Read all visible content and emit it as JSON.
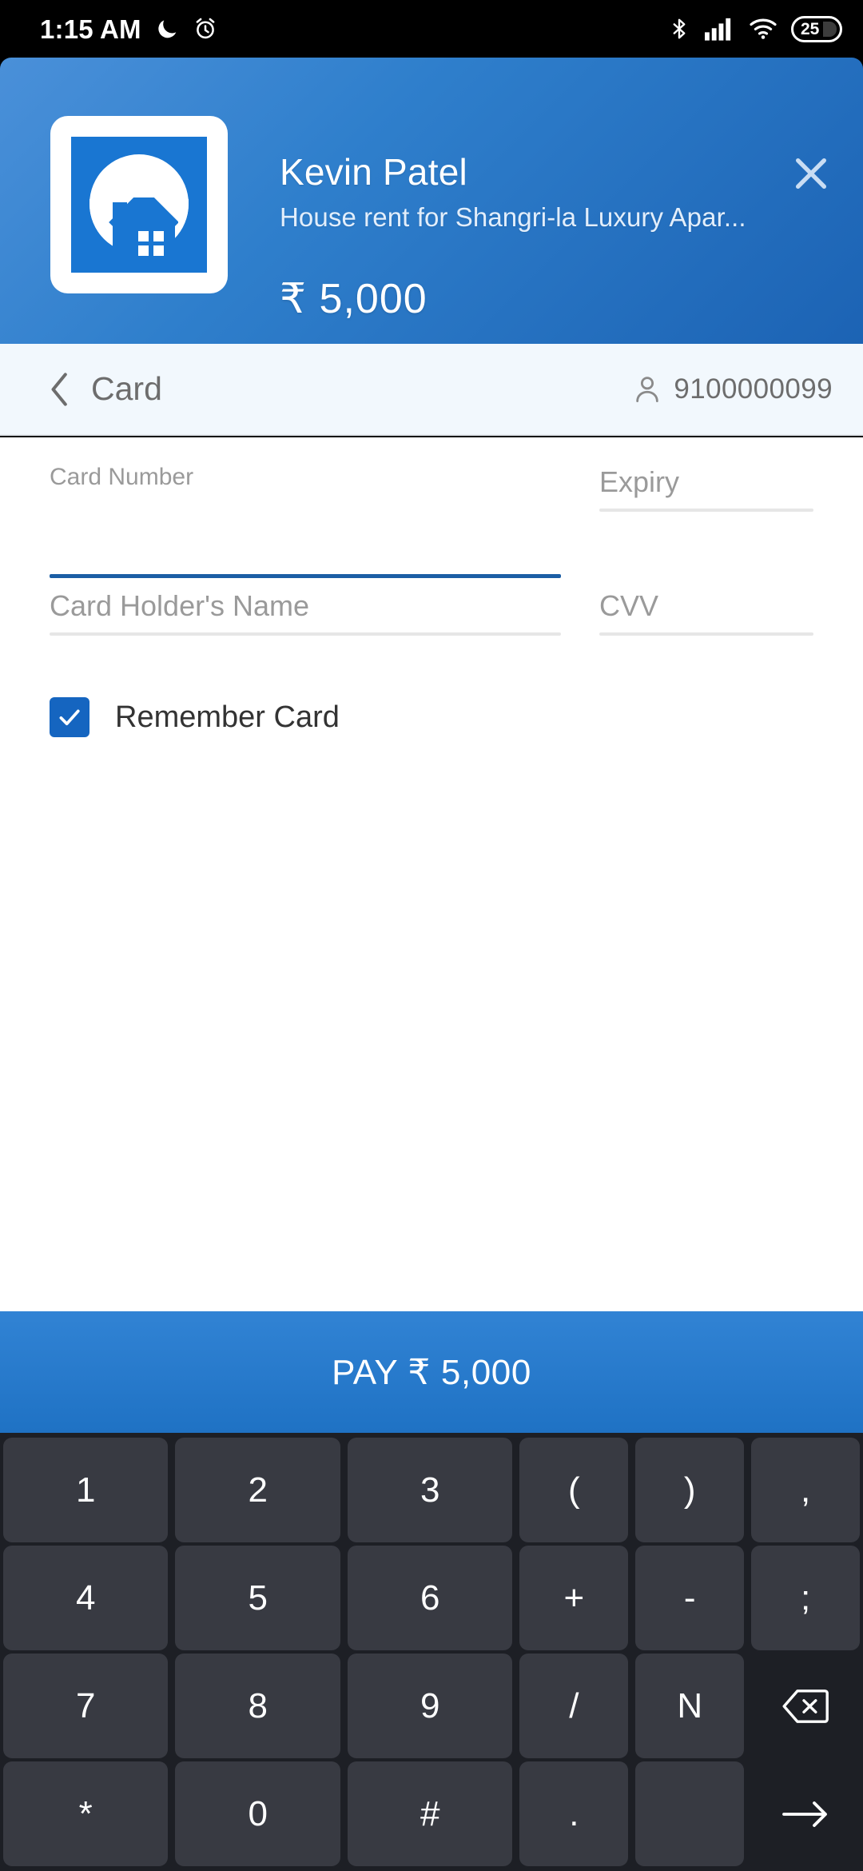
{
  "statusbar": {
    "time": "1:15 AM",
    "icons_left": [
      "moon-icon",
      "alarm-icon"
    ],
    "icons_right": [
      "bluetooth-icon",
      "signal-icon",
      "wifi-icon",
      "battery-icon"
    ],
    "battery_level": "25"
  },
  "header": {
    "payee_name": "Kevin Patel",
    "purpose": "House rent for Shangri-la Luxury Apar...",
    "amount": "₹ 5,000",
    "close_label": "×",
    "merchant_logo": "house-logo-icon",
    "gradient_from": "#4a90d9",
    "gradient_to": "#1c63b4"
  },
  "navbar": {
    "back_icon": "chevron-left-icon",
    "title": "Card",
    "user_icon": "person-icon",
    "phone": "9100000099"
  },
  "form": {
    "card_number": {
      "label": "Card Number",
      "value": "",
      "placeholder": "",
      "focused": true
    },
    "expiry": {
      "label": "Expiry",
      "value": "",
      "placeholder": "Expiry",
      "focused": false
    },
    "card_holder": {
      "label": "Card Holder's Name",
      "value": "",
      "placeholder": "Card Holder's Name",
      "focused": false
    },
    "cvv": {
      "label": "CVV",
      "value": "",
      "placeholder": "CVV",
      "focused": false
    },
    "remember_card": {
      "label": "Remember Card",
      "checked": true,
      "accent": "#1565c0"
    }
  },
  "pay_button": {
    "label": "PAY ₹ 5,000",
    "color": "#2377c8"
  },
  "keyboard": {
    "rows": [
      [
        {
          "label": "1",
          "type": "wide"
        },
        {
          "label": "2",
          "type": "wide"
        },
        {
          "label": "3",
          "type": "wide"
        },
        {
          "label": "(",
          "type": "narrow"
        },
        {
          "label": ")",
          "type": "narrow"
        },
        {
          "label": ",",
          "type": "narrow"
        }
      ],
      [
        {
          "label": "4",
          "type": "wide"
        },
        {
          "label": "5",
          "type": "wide"
        },
        {
          "label": "6",
          "type": "wide"
        },
        {
          "label": "+",
          "type": "narrow"
        },
        {
          "label": "-",
          "type": "narrow"
        },
        {
          "label": ";",
          "type": "narrow"
        }
      ],
      [
        {
          "label": "7",
          "type": "wide"
        },
        {
          "label": "8",
          "type": "wide"
        },
        {
          "label": "9",
          "type": "wide"
        },
        {
          "label": "/",
          "type": "narrow"
        },
        {
          "label": "N",
          "type": "narrow"
        },
        {
          "label": "",
          "type": "ghost",
          "icon": "backspace-icon"
        }
      ],
      [
        {
          "label": "*",
          "type": "wide"
        },
        {
          "label": "0",
          "type": "wide"
        },
        {
          "label": "#",
          "type": "wide"
        },
        {
          "label": ".",
          "type": "narrow"
        },
        {
          "label": "",
          "type": "blank"
        },
        {
          "label": "",
          "type": "ghost",
          "icon": "arrow-right-icon"
        }
      ]
    ]
  }
}
